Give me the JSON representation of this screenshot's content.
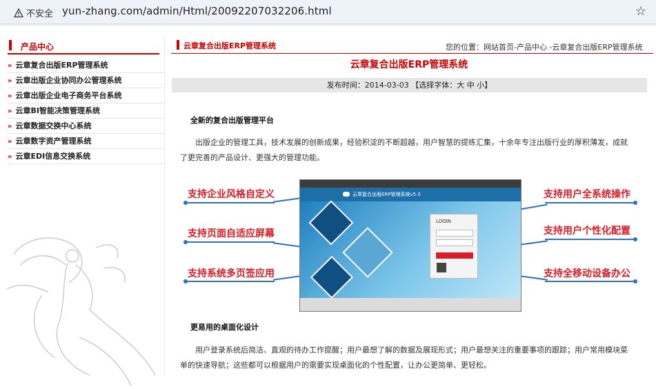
{
  "browser": {
    "security_label": "不安全",
    "url": "yun-zhang.com/admin/Html/20092207032206.html"
  },
  "sidebar": {
    "title": "产品中心",
    "items": [
      {
        "label": "云章复合出版ERP管理系统"
      },
      {
        "label": "云章出版企业协同办公管理系统"
      },
      {
        "label": "云章出版企业电子商务平台系统"
      },
      {
        "label": "云章BI智能决策管理系统"
      },
      {
        "label": "云章数据交换中心系统"
      },
      {
        "label": "云章数字资产管理系统"
      },
      {
        "label": "云章EDI信息交换系统"
      }
    ]
  },
  "main": {
    "section_title": "云章复合出版ERP管理系统",
    "breadcrumb": "您的位置：网站首页-产品中心 -云章复合出版ERP管理系统",
    "article_title": "云章复合出版ERP管理系统",
    "publish": "发布时间：2014-03-03 【选择字体：大 中 小】",
    "heading1": "全新的复合出版管理平台",
    "para1": "出版企业的管理工具，技术发展的创新成果，经验积淀的不断超越，用户智慧的提练汇集，十余年专注出版行业的厚积薄发，成就了更完善的产品设计、更强大的管理功能。",
    "features_left": [
      "支持企业风格自定义",
      "支持页面自适应屏幕",
      "支持系统多页签应用"
    ],
    "features_right": [
      "支持用户全系统操作",
      "支持用户个性化配置",
      "支持全移动设备办公"
    ],
    "screenshot": {
      "header": "云章复合出版ERP管理系统v5.0",
      "login": "LOGIN"
    },
    "heading2": "更易用的桌面化设计",
    "para2": "用户登录系统后简洁、直观的待办工作提醒；用户最想了解的数据及展现形式；用户最想关注的重要事项的跟踪；用户常用模块菜单的快速导航；这些都可以根据用户的需要实现桌面化的个性配置，让办公更简单、更轻松。"
  },
  "colors": {
    "accent": "#cc0000",
    "line": "#2e6fbf"
  }
}
